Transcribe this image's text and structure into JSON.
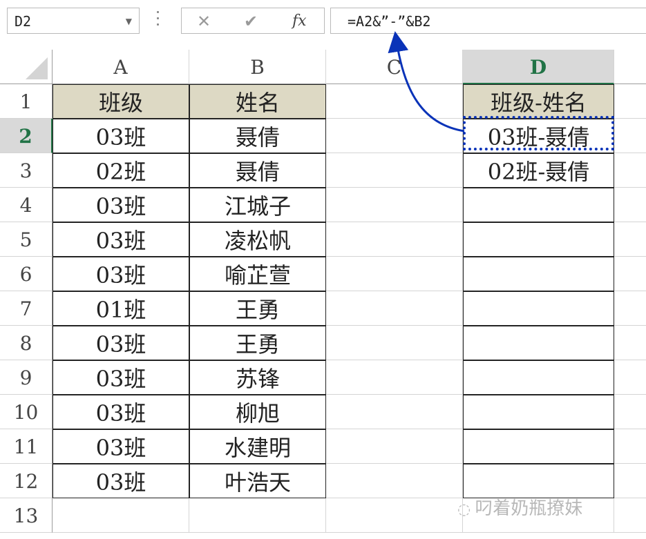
{
  "formula_bar": {
    "name_box": "D2",
    "formula": "=A2&”-”&B2",
    "cancel_icon": "✕",
    "enter_icon": "✔",
    "fx_label": "fx"
  },
  "columns": [
    "A",
    "B",
    "C",
    "D"
  ],
  "selected_column": "D",
  "rows": [
    "1",
    "2",
    "3",
    "4",
    "5",
    "6",
    "7",
    "8",
    "9",
    "10",
    "11",
    "12",
    "13"
  ],
  "selected_row": "2",
  "table": {
    "header": {
      "a": "班级",
      "b": "姓名"
    },
    "rows": [
      {
        "a": "03班",
        "b": "聂倩"
      },
      {
        "a": "02班",
        "b": "聂倩"
      },
      {
        "a": "03班",
        "b": "江城子"
      },
      {
        "a": "03班",
        "b": "凌松帆"
      },
      {
        "a": "03班",
        "b": "喻芷萱"
      },
      {
        "a": "01班",
        "b": "王勇"
      },
      {
        "a": "03班",
        "b": "王勇"
      },
      {
        "a": "03班",
        "b": "苏锋"
      },
      {
        "a": "03班",
        "b": "柳旭"
      },
      {
        "a": "03班",
        "b": "水建明"
      },
      {
        "a": "03班",
        "b": "叶浩天"
      }
    ]
  },
  "result": {
    "header": "班级-姓名",
    "values": [
      "03班-聂倩",
      "02班-聂倩"
    ]
  },
  "watermark": "叼着奶瓶撩妹",
  "colors": {
    "accent": "#217346",
    "selection": "#0a33b8",
    "header_fill": "#ddd9c4"
  }
}
